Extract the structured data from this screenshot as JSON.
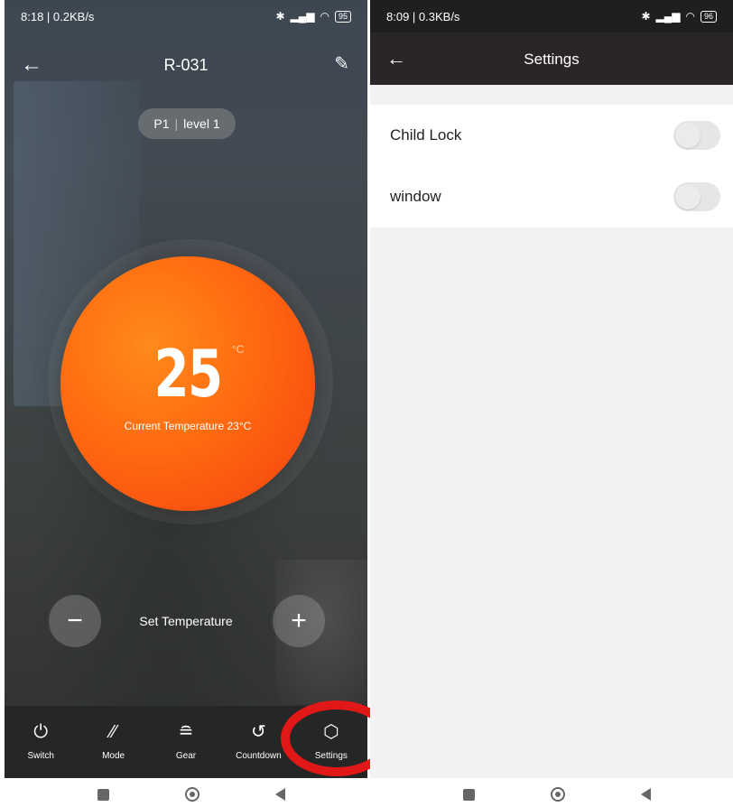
{
  "left_screen": {
    "status_bar": {
      "time_speed": "8:18 | 0.2KB/s",
      "battery": "95"
    },
    "header": {
      "title": "R-031"
    },
    "preset": {
      "program": "P1",
      "level": "level 1"
    },
    "dial": {
      "set_temp": "25",
      "unit": "°C",
      "current_text": "Current Temperature 23°C",
      "color_start": "#ff8a1a",
      "color_end": "#f4400f"
    },
    "controls": {
      "set_label": "Set Temperature",
      "minus": "−",
      "plus": "+"
    },
    "tabs": [
      {
        "label": "Switch",
        "icon": "power-icon"
      },
      {
        "label": "Mode",
        "icon": "mode-icon"
      },
      {
        "label": "Gear",
        "icon": "gear-level-icon"
      },
      {
        "label": "Countdown",
        "icon": "countdown-icon"
      },
      {
        "label": "Settings",
        "icon": "settings-cube-icon"
      }
    ],
    "highlight_color": "#e01818"
  },
  "right_screen": {
    "status_bar": {
      "time_speed": "8:09 | 0.3KB/s",
      "battery": "96"
    },
    "header": {
      "title": "Settings"
    },
    "settings": [
      {
        "label": "Child Lock",
        "enabled": false
      },
      {
        "label": "window",
        "enabled": false
      }
    ]
  }
}
